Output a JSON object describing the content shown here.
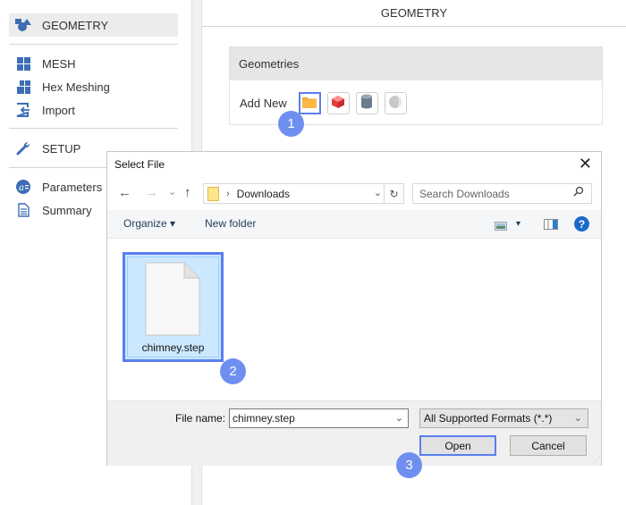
{
  "sidebar": {
    "items": [
      {
        "label": "GEOMETRY",
        "icon": "shapes-icon",
        "active": true
      },
      {
        "label": "MESH",
        "icon": "grid-icon"
      },
      {
        "label": "Hex Meshing",
        "icon": "hex-grid-icon"
      },
      {
        "label": "Import",
        "icon": "import-icon"
      },
      {
        "label": "SETUP",
        "icon": "wrench-icon"
      },
      {
        "label": "Parameters",
        "icon": "parameters-icon"
      },
      {
        "label": "Summary",
        "icon": "document-icon"
      }
    ]
  },
  "main": {
    "title": "GEOMETRY",
    "panel_title": "Geometries",
    "add_new_label": "Add New",
    "tools": [
      "folder-icon",
      "cube-icon",
      "cylinder-icon",
      "sphere-icon"
    ]
  },
  "badges": [
    "1",
    "2",
    "3"
  ],
  "dialog": {
    "title": "Select File",
    "close": "✕",
    "nav": {
      "back": "←",
      "forward": "→",
      "recent": "⌄",
      "up": "↑"
    },
    "address": {
      "chevron": "›",
      "path": "Downloads"
    },
    "search_placeholder": "Search Downloads",
    "toolbar": {
      "organize": "Organize ▾",
      "new_folder": "New folder",
      "view_caret": "▾",
      "help": "?"
    },
    "files": [
      {
        "name": "chimney.step",
        "selected": true
      }
    ],
    "file_name_label": "File name:",
    "file_name_value": "chimney.step",
    "file_type": "All Supported Formats (*.*)",
    "open_label": "Open",
    "cancel_label": "Cancel"
  },
  "colors": {
    "accent": "#5b7ff0",
    "badge": "#6f8ff0",
    "nav_icon": "#3e6db5",
    "selection": "#cce8ff"
  }
}
